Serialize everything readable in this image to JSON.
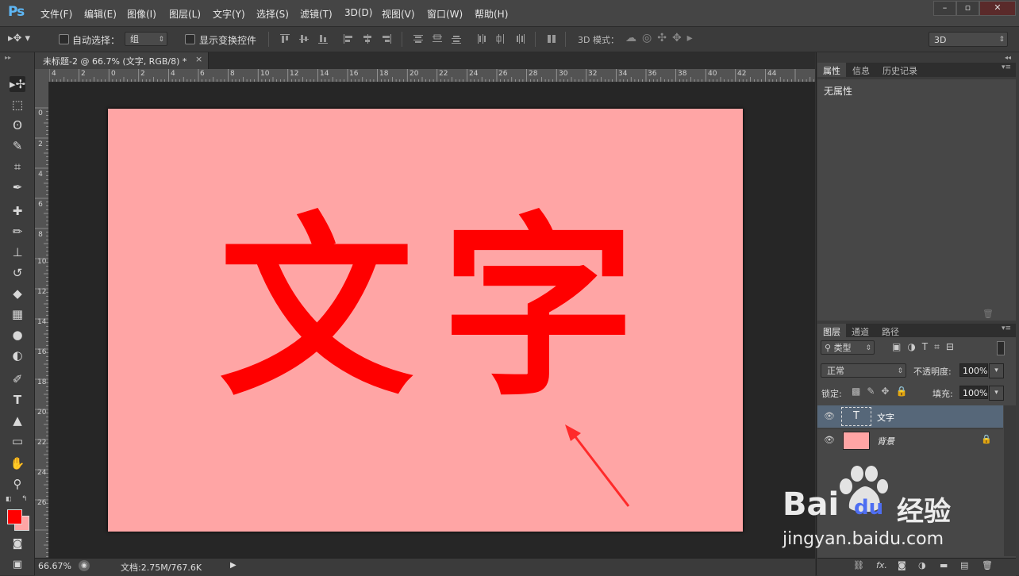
{
  "app": {
    "logo": "Ps"
  },
  "menu": [
    "文件(F)",
    "编辑(E)",
    "图像(I)",
    "图层(L)",
    "文字(Y)",
    "选择(S)",
    "滤镜(T)",
    "3D(D)",
    "视图(V)",
    "窗口(W)",
    "帮助(H)"
  ],
  "window_controls": {
    "minimize": "–",
    "restore": "▫",
    "close": "✕"
  },
  "options": {
    "auto_select_label": "自动选择：",
    "auto_select_value": "组",
    "show_transform_label": "显示变换控件",
    "mode3d_label": "3D 模式：",
    "workspace_value": "3D"
  },
  "document_tab": {
    "title": "未标题-2 @ 66.7% (文字, RGB/8) *",
    "close": "×"
  },
  "ruler": {
    "h_labels": [
      "4",
      "2",
      "0",
      "2",
      "4",
      "6",
      "8",
      "10",
      "12",
      "14",
      "16",
      "18",
      "20",
      "22",
      "24",
      "26",
      "28",
      "30",
      "32",
      "34",
      "36",
      "38",
      "40",
      "42",
      "44"
    ],
    "v_labels": [
      "0",
      "2",
      "4",
      "6",
      "8",
      "10",
      "12",
      "14",
      "16",
      "18",
      "20",
      "22",
      "24",
      "26"
    ]
  },
  "canvas": {
    "text": "文字",
    "char1": "文",
    "char2": "字",
    "bg_color": "#ffa5a5",
    "text_color": "#ff0000"
  },
  "status": {
    "zoom": "66.67%",
    "doc_info": "文档:2.75M/767.6K"
  },
  "properties_panel": {
    "tabs": [
      "属性",
      "信息",
      "历史记录"
    ],
    "content": "无属性"
  },
  "layers_panel": {
    "tabs": [
      "图层",
      "通道",
      "路径"
    ],
    "filter_label": "类型",
    "blend_mode": "正常",
    "opacity_label": "不透明度:",
    "opacity_value": "100%",
    "lock_label": "锁定:",
    "fill_label": "填充:",
    "fill_value": "100%",
    "layers": [
      {
        "name": "文字",
        "type": "text",
        "selected": true
      },
      {
        "name": "背景",
        "type": "background",
        "locked": true
      }
    ]
  },
  "watermark": {
    "brand": "Bai",
    "brand2": "du",
    "suffix": "经验",
    "url": "jingyan.baidu.com"
  },
  "colors": {
    "accent_blue": "#5eb7f5",
    "selected_layer": "#566779",
    "arrow_red": "#ff2020",
    "foreground": "#ff0000",
    "background": "#ffa5a5"
  }
}
